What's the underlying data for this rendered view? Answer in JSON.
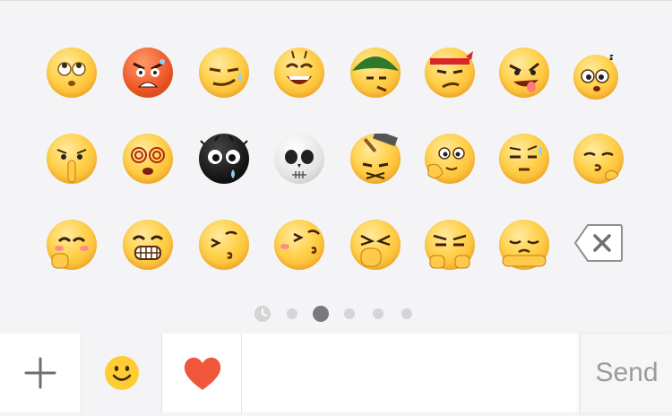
{
  "emoji_panel": {
    "rows": [
      [
        "rolling-eyes-emoji",
        "angry-red-emoji",
        "smirk-sweat-emoji",
        "grin-emoji",
        "army-helmet-emoji",
        "headband-emoji",
        "tongue-out-emoji",
        "confused-question-emoji"
      ],
      [
        "shush-emoji",
        "dizzy-emoji",
        "black-bug-emoji",
        "skull-emoji",
        "hammer-hit-emoji",
        "thinking-emoji",
        "sweat-emoji",
        "pouting-emoji"
      ],
      [
        "blushing-emoji",
        "teeth-grin-emoji",
        "kissing-emoji",
        "cheek-kiss-emoji",
        "hand-over-mouth-emoji",
        "fists-emoji",
        "sulking-emoji"
      ]
    ],
    "delete_icon": "backspace-icon"
  },
  "pager": {
    "pages": 5,
    "active_page": 2,
    "recent_icon": "clock-icon"
  },
  "bottom_bar": {
    "add_icon": "plus-icon",
    "emoji_tab_icon": "smiley-icon",
    "favorites_icon": "heart-icon",
    "send_label": "Send"
  },
  "colors": {
    "accent_heart": "#f0573a",
    "send_text": "#9b9b9b",
    "panel_bg": "#f4f4f6"
  }
}
